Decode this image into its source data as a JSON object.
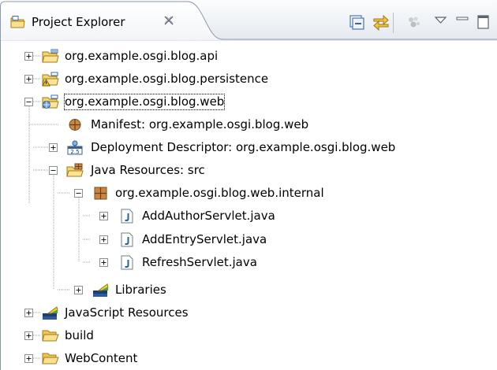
{
  "view": {
    "title": "Project Explorer",
    "close_glyph": "✕"
  },
  "toolbar": {
    "buttons": [
      {
        "name": "collapse-all-button",
        "icon": "collapse-all-icon"
      },
      {
        "name": "link-with-editor-button",
        "icon": "link-with-editor-icon"
      },
      {
        "name": "filters-button",
        "icon": "filters-icon"
      },
      {
        "name": "view-menu-button",
        "icon": "chevron-down-icon"
      },
      {
        "name": "minimize-button",
        "icon": "minimize-icon"
      },
      {
        "name": "maximize-button",
        "icon": "maximize-icon"
      }
    ]
  },
  "tree": {
    "items": [
      {
        "label": "org.example.osgi.blog.api",
        "icon": "plugin-project-icon",
        "expanded": false
      },
      {
        "label": "org.example.osgi.blog.persistence",
        "icon": "plugin-project-warning-icon",
        "expanded": false
      },
      {
        "label": "org.example.osgi.blog.web",
        "icon": "web-project-icon",
        "expanded": true,
        "selected": true
      },
      {
        "label": "Manifest: org.example.osgi.blog.web",
        "icon": "manifest-icon"
      },
      {
        "label": "Deployment Descriptor: org.example.osgi.blog.web",
        "icon": "deployment-descriptor-icon",
        "expanded": false
      },
      {
        "label": "Java Resources: src",
        "icon": "java-resources-icon",
        "expanded": true
      },
      {
        "label": "org.example.osgi.blog.web.internal",
        "icon": "package-icon",
        "expanded": true
      },
      {
        "label": "AddAuthorServlet.java",
        "icon": "java-file-icon",
        "expanded": false
      },
      {
        "label": "AddEntryServlet.java",
        "icon": "java-file-icon",
        "expanded": false
      },
      {
        "label": "RefreshServlet.java",
        "icon": "java-file-icon",
        "expanded": false
      },
      {
        "label": "Libraries",
        "icon": "libraries-icon",
        "expanded": false
      },
      {
        "label": "JavaScript Resources",
        "icon": "libraries-icon",
        "expanded": false
      },
      {
        "label": "build",
        "icon": "folder-icon",
        "expanded": false
      },
      {
        "label": "WebContent",
        "icon": "folder-icon",
        "expanded": false
      }
    ]
  },
  "colors": {
    "header_gradient_top": "#fafbfd",
    "header_gradient_bottom": "#dfe5ef",
    "tab_border": "#8d99a8",
    "folder": "#f3c451",
    "java_blue": "#2a5ea8"
  }
}
